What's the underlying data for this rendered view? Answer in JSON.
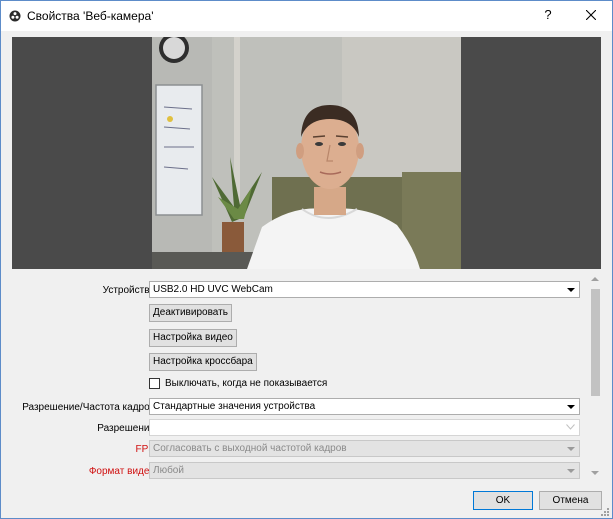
{
  "window": {
    "title": "Свойства 'Веб-камера'",
    "help_glyph": "?"
  },
  "preview": {
    "image_description": "webcam preview"
  },
  "settings": {
    "device": {
      "label": "Устройство",
      "value": "USB2.0 HD UVC WebCam"
    },
    "deactivate_button": "Деактивировать",
    "video_config_button": "Настройка видео",
    "crossbar_config_button": "Настройка кроссбара",
    "deactivate_when_hidden": {
      "label": "Выключать, когда не показывается",
      "checked": false
    },
    "res_fps_type": {
      "label": "Разрешение/Частота кадров",
      "value": "Стандартные значения устройства"
    },
    "resolution": {
      "label": "Разрешение",
      "value": ""
    },
    "fps": {
      "label": "FPS",
      "value": "Согласовать с выходной частотой кадров"
    },
    "video_format": {
      "label": "Формат видео",
      "value": "Любой"
    }
  },
  "footer": {
    "ok_label": "OK",
    "cancel_label": "Отмена"
  },
  "colors": {
    "accent": "#0078d7",
    "warning_label": "#d01010",
    "preview_bg": "#4a4a4a"
  },
  "icons": [
    "obs-app-icon",
    "help-icon",
    "close-icon",
    "dropdown-arrow-icon",
    "chevron-down-icon",
    "resize-grip-icon"
  ]
}
